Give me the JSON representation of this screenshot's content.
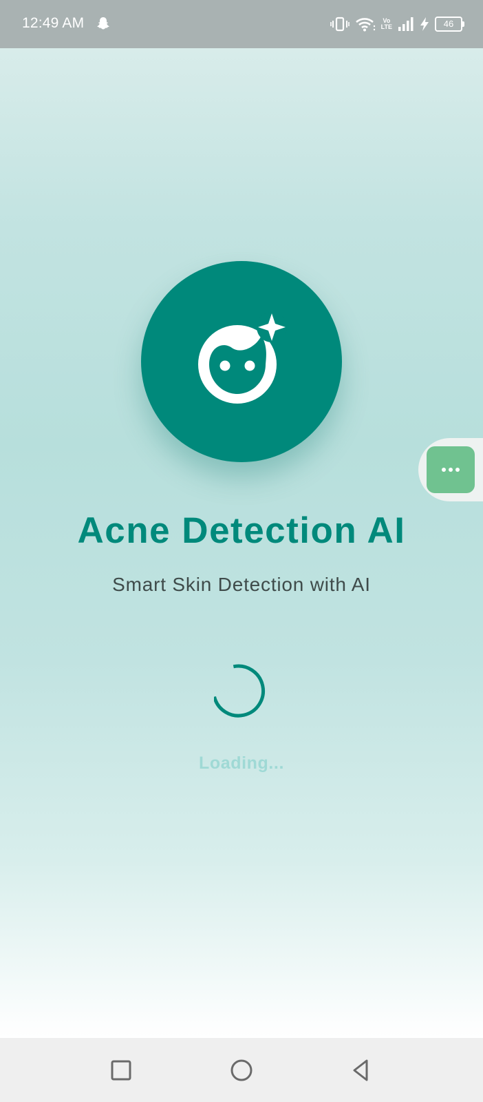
{
  "status_bar": {
    "time": "12:49 AM",
    "volte_top": "Vo",
    "volte_bottom": "LTE",
    "battery": "46",
    "icons": [
      "snapchat-icon",
      "vibrate-icon",
      "wifi-icon",
      "volte-icon",
      "signal-icon",
      "charging-icon",
      "battery-icon"
    ]
  },
  "app": {
    "title": "Acne Detection AI",
    "subtitle": "Smart Skin Detection with AI",
    "loading_text": "Loading...",
    "logo_icon": "face-retouching-icon",
    "accent_color": "#00897b"
  },
  "floating_button": {
    "icon": "more-horizontal-icon",
    "color": "#70c290"
  },
  "nav_bar": {
    "buttons": [
      "recents-button",
      "home-button",
      "back-button"
    ]
  }
}
